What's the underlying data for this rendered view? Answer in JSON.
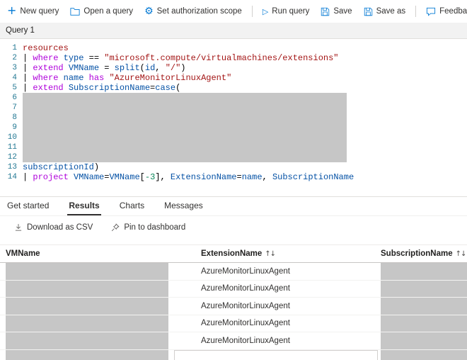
{
  "colors": {
    "accent": "#0078d4",
    "text": "#323130",
    "redaction": "#c6c6c6",
    "line_number": "#237893",
    "tab_underline": "#323130",
    "syntax": {
      "keyword": "#af00db",
      "identifier": "#0451a5",
      "function": "#0451a5",
      "string": "#a31515",
      "table": "#a31515",
      "number": "#098658",
      "plain": "#000000"
    }
  },
  "toolbar": {
    "items": [
      {
        "label": "New query",
        "icon": "plus-icon"
      },
      {
        "label": "Open a query",
        "icon": "folder-open-icon"
      },
      {
        "label": "Set authorization scope",
        "icon": "gear-icon"
      },
      {
        "label": "Run query",
        "icon": "play-icon"
      },
      {
        "label": "Save",
        "icon": "save-icon"
      },
      {
        "label": "Save as",
        "icon": "save-as-icon"
      },
      {
        "label": "Feedback",
        "icon": "feedback-icon"
      }
    ]
  },
  "query_tab": {
    "label": "Query 1"
  },
  "editor": {
    "redacted_lines": "6-12",
    "lines": [
      {
        "num": "1",
        "tokens": [
          [
            "table",
            "resources"
          ]
        ]
      },
      {
        "num": "2",
        "tokens": [
          [
            "plain",
            "| "
          ],
          [
            "kw",
            "where"
          ],
          [
            "plain",
            " "
          ],
          [
            "ident",
            "type"
          ],
          [
            "plain",
            " == "
          ],
          [
            "str",
            "\"microsoft.compute/virtualmachines/extensions\""
          ]
        ]
      },
      {
        "num": "3",
        "tokens": [
          [
            "plain",
            "| "
          ],
          [
            "kw",
            "extend"
          ],
          [
            "plain",
            " "
          ],
          [
            "ident",
            "VMName"
          ],
          [
            "plain",
            " = "
          ],
          [
            "fn",
            "split"
          ],
          [
            "plain",
            "("
          ],
          [
            "ident",
            "id"
          ],
          [
            "plain",
            ", "
          ],
          [
            "str",
            "\"/\""
          ],
          [
            "plain",
            ")"
          ]
        ]
      },
      {
        "num": "4",
        "tokens": [
          [
            "plain",
            "| "
          ],
          [
            "kw",
            "where"
          ],
          [
            "plain",
            " "
          ],
          [
            "ident",
            "name"
          ],
          [
            "plain",
            " "
          ],
          [
            "kw",
            "has"
          ],
          [
            "plain",
            " "
          ],
          [
            "str",
            "\"AzureMonitorLinuxAgent\""
          ]
        ]
      },
      {
        "num": "5",
        "tokens": [
          [
            "plain",
            "| "
          ],
          [
            "kw",
            "extend"
          ],
          [
            "plain",
            " "
          ],
          [
            "ident",
            "SubscriptionName"
          ],
          [
            "plain",
            "="
          ],
          [
            "fn",
            "case"
          ],
          [
            "plain",
            "("
          ]
        ]
      },
      {
        "num": "6",
        "tokens": []
      },
      {
        "num": "7",
        "tokens": []
      },
      {
        "num": "8",
        "tokens": []
      },
      {
        "num": "9",
        "tokens": []
      },
      {
        "num": "10",
        "tokens": []
      },
      {
        "num": "11",
        "tokens": []
      },
      {
        "num": "12",
        "tokens": []
      },
      {
        "num": "13",
        "tokens": [
          [
            "ident",
            "subscriptionId"
          ],
          [
            "plain",
            ")"
          ]
        ]
      },
      {
        "num": "14",
        "tokens": [
          [
            "plain",
            "| "
          ],
          [
            "kw",
            "project"
          ],
          [
            "plain",
            " "
          ],
          [
            "ident",
            "VMName"
          ],
          [
            "plain",
            "="
          ],
          [
            "ident",
            "VMName"
          ],
          [
            "plain",
            "["
          ],
          [
            "num",
            "-3"
          ],
          [
            "plain",
            "], "
          ],
          [
            "ident",
            "ExtensionName"
          ],
          [
            "plain",
            "="
          ],
          [
            "ident",
            "name"
          ],
          [
            "plain",
            ", "
          ],
          [
            "ident",
            "SubscriptionName"
          ]
        ]
      }
    ]
  },
  "tabs": {
    "items": [
      {
        "label": "Get started",
        "active": false
      },
      {
        "label": "Results",
        "active": true
      },
      {
        "label": "Charts",
        "active": false
      },
      {
        "label": "Messages",
        "active": false
      }
    ]
  },
  "results_toolbar": {
    "download_csv": "Download as CSV",
    "pin_dashboard": "Pin to dashboard"
  },
  "table": {
    "sort_glyph": "↑↓",
    "columns": [
      {
        "label": "VMName",
        "sortable": false
      },
      {
        "label": "ExtensionName",
        "sortable": true
      },
      {
        "label": "SubscriptionName",
        "sortable": true
      }
    ],
    "rows": [
      {
        "vm_redacted": true,
        "extension": "AzureMonitorLinuxAgent",
        "subscription_redacted": true
      },
      {
        "vm_redacted": true,
        "extension": "AzureMonitorLinuxAgent",
        "subscription_redacted": true
      },
      {
        "vm_redacted": true,
        "extension": "AzureMonitorLinuxAgent",
        "subscription_redacted": true
      },
      {
        "vm_redacted": true,
        "extension": "AzureMonitorLinuxAgent",
        "subscription_redacted": true
      },
      {
        "vm_redacted": true,
        "extension": "AzureMonitorLinuxAgent",
        "subscription_redacted": true
      }
    ],
    "partial_row": {
      "vm_redacted": true,
      "subscription_redacted": true
    }
  }
}
